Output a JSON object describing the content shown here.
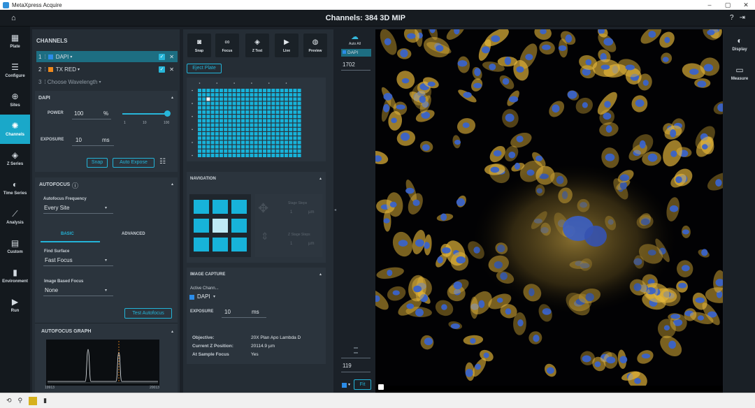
{
  "window": {
    "title": "MetaXpress Acquire",
    "controls": [
      "–",
      "▢",
      "✕"
    ]
  },
  "header": {
    "title": "Channels: 384 3D MIP"
  },
  "leftnav": [
    {
      "label": "Plate",
      "icon": "▦"
    },
    {
      "label": "Configure",
      "icon": "☰"
    },
    {
      "label": "Sites",
      "icon": "⊕"
    },
    {
      "label": "Channels",
      "icon": "✺"
    },
    {
      "label": "Z Series",
      "icon": "◈"
    },
    {
      "label": "Time Series",
      "icon": "◐"
    },
    {
      "label": "Analysis",
      "icon": "⟋"
    },
    {
      "label": "Custom",
      "icon": "▤"
    },
    {
      "label": "Environment",
      "icon": "🌡"
    },
    {
      "label": "Run",
      "icon": "▶"
    }
  ],
  "channels": {
    "heading": "CHANNELS",
    "rows": [
      {
        "num": "1",
        "name": "DAPI",
        "color": "#2b8ce8"
      },
      {
        "num": "2",
        "name": "TX RED",
        "color": "#f08a1c"
      }
    ],
    "add_row": {
      "num": "3",
      "label": "Choose Wavelength"
    }
  },
  "dapi_panel": {
    "title": "DAPI",
    "power_label": "POWER",
    "power_value": "100",
    "power_unit": "%",
    "slider_ticks": [
      "1",
      "10",
      "100"
    ],
    "exposure_label": "EXPOSURE",
    "exposure_value": "10",
    "exposure_unit": "ms",
    "snap_label": "Snap",
    "auto_expose_label": "Auto Expose",
    "power_level_percent": 100
  },
  "autofocus": {
    "title": "AUTOFOCUS",
    "frequency_label": "Autofocus Frequency",
    "frequency_value": "Every Site",
    "tab_basic": "BASIC",
    "tab_advanced": "ADVANCED",
    "find_surface_label": "Find Surface",
    "find_surface_value": "Fast Focus",
    "image_focus_label": "Image Based Focus",
    "image_focus_value": "None",
    "test_button": "Test Autofocus",
    "graph_title": "AUTOFOCUS GRAPH",
    "graph_x_min": "19913",
    "graph_x_max": "20013"
  },
  "toolbar": {
    "snap": "Snap",
    "focus": "Focus",
    "ztest": "Z Test",
    "live": "Live",
    "preview": "Preview"
  },
  "plate": {
    "eject": "Eject Plate",
    "rows": 16,
    "cols": 24,
    "selected_well": "C3"
  },
  "navigation": {
    "title": "NAVIGATION",
    "stage_step_label": "Stage Steps",
    "stage_step_value": "1",
    "stage_step_unit": "µm",
    "z_step_label": "Z Stage Steps",
    "z_step_value": "1",
    "z_step_unit": "µm"
  },
  "image_capture": {
    "title": "IMAGE CAPTURE",
    "active_channel_label": "Active Chann...",
    "active_channel_value": "DAPI",
    "exposure_label": "EXPOSURE",
    "exposure_value": "10",
    "exposure_unit": "ms",
    "objective_label": "Objective:",
    "objective_value": "20X Plan Apo Lambda D",
    "z_position_label": "Current Z Position:",
    "z_position_value": "20114.9 µm",
    "sample_focus_label": "At Sample Focus",
    "sample_focus_value": "Yes"
  },
  "display_scale": {
    "auto_all": "Auto All",
    "channel": "DAPI",
    "max": "1702",
    "min": "119",
    "fit": "Fit"
  },
  "rightnav": [
    {
      "label": "Display",
      "icon": "◐"
    },
    {
      "label": "Measure",
      "icon": "▭"
    }
  ],
  "colors": {
    "accent": "#23b4d8",
    "well": "#17b3da",
    "dapi": "#2b8ce8",
    "txred": "#f08a1c",
    "cell_membrane": "#e7b83b",
    "nucleus": "#3a63c9"
  }
}
